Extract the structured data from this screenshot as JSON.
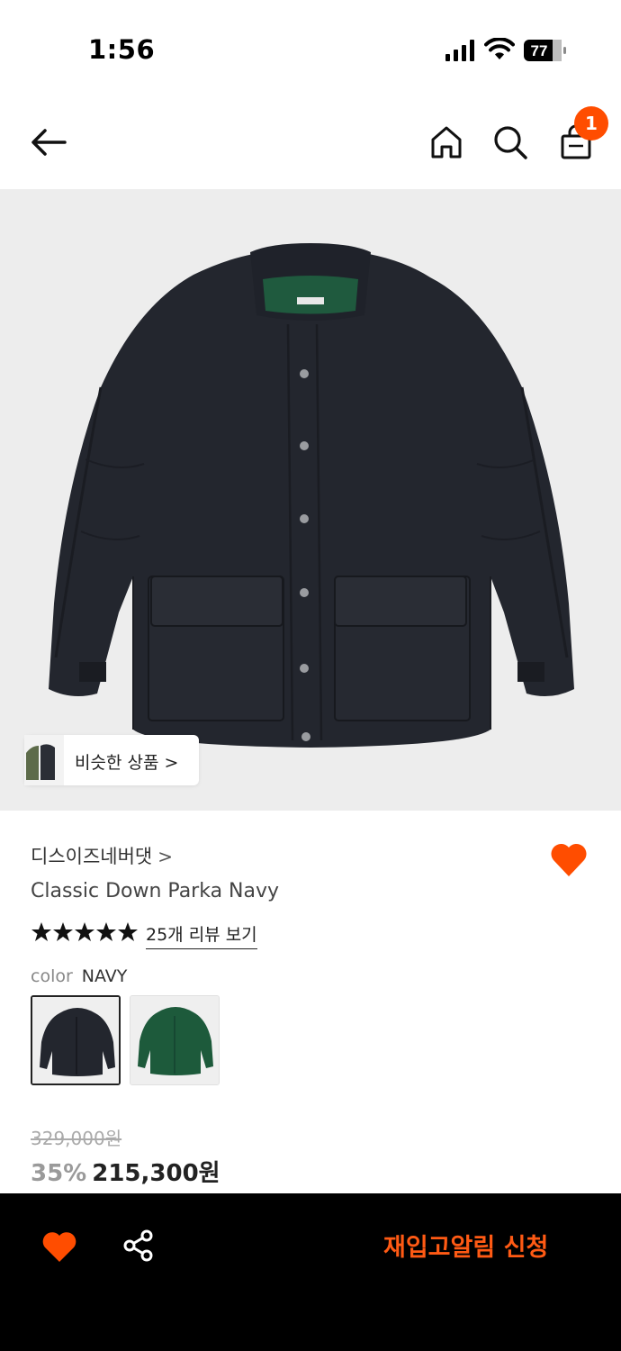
{
  "status_bar": {
    "time": "1:56",
    "battery": "77"
  },
  "header": {
    "back_icon": "arrow-left-icon",
    "home_icon": "home-icon",
    "search_icon": "search-icon",
    "bag_icon": "shopping-bag-icon",
    "cart_count": "1"
  },
  "hero": {
    "similar_label": "비슷한 상품 >"
  },
  "product": {
    "brand": "디스이즈네버댓",
    "brand_chevron": ">",
    "name": "Classic Down Parka Navy",
    "rating_stars": 5,
    "review_link": "25개 리뷰 보기",
    "color_key": "color",
    "color_value": "NAVY",
    "swatches": [
      "navy",
      "green"
    ]
  },
  "price": {
    "original": "329,000원",
    "discount": "35%",
    "final": "215,300원"
  },
  "bottom_bar": {
    "restock_label": "재입고알림 신청"
  },
  "colors": {
    "accent": "#ff4d00",
    "restock_text": "#ff5a14",
    "bottom_bar_bg": "#000000",
    "hero_bg": "#ededed",
    "jacket_navy": "#23262e",
    "jacket_green": "#1d5a3b"
  }
}
